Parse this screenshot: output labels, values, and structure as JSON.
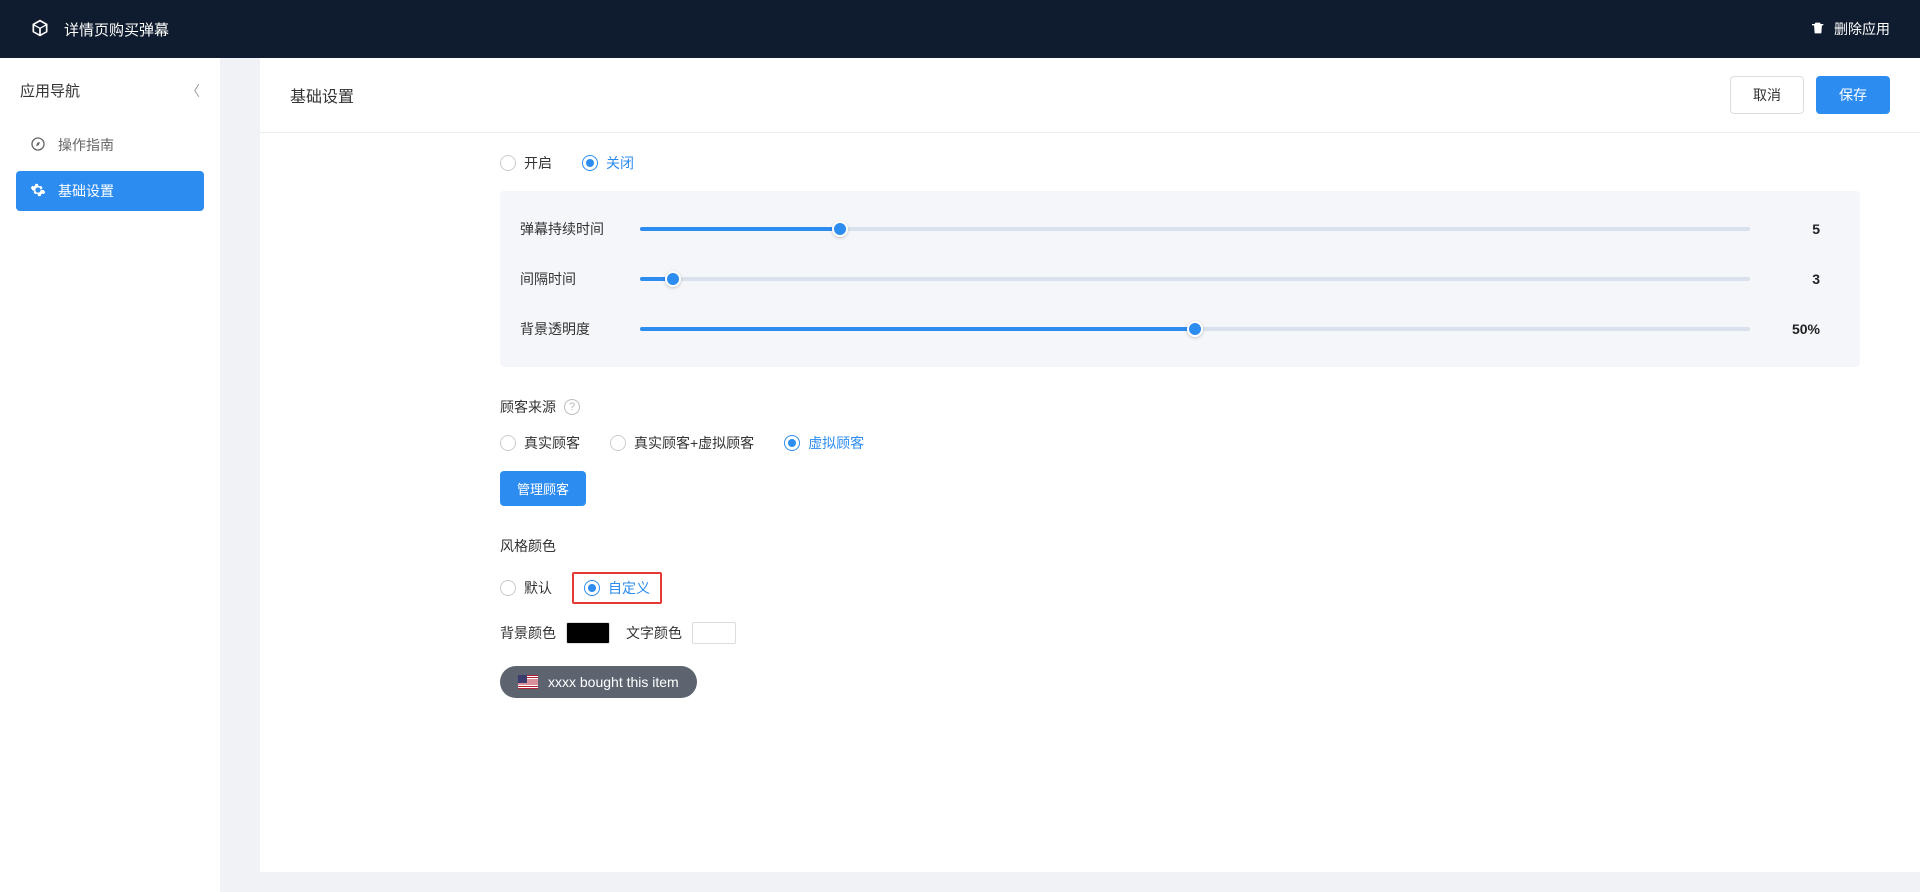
{
  "topbar": {
    "title": "详情页购买弹幕",
    "delete_label": "删除应用"
  },
  "sidebar": {
    "header": "应用导航",
    "items": [
      {
        "label": "操作指南"
      },
      {
        "label": "基础设置"
      }
    ]
  },
  "page": {
    "title": "基础设置",
    "cancel_label": "取消",
    "save_label": "保存"
  },
  "enable_section": {
    "options": {
      "on": "开启",
      "off": "关闭"
    },
    "selected": "off"
  },
  "sliders": {
    "duration": {
      "label": "弹幕持续时间",
      "value": "5",
      "percent": 18
    },
    "interval": {
      "label": "间隔时间",
      "value": "3",
      "percent": 3
    },
    "opacity": {
      "label": "背景透明度",
      "value": "50%",
      "percent": 50
    }
  },
  "customer_source": {
    "label": "顾客来源",
    "options": {
      "real": "真实顾客",
      "real_virtual": "真实顾客+虚拟顾客",
      "virtual": "虚拟顾客"
    },
    "selected": "virtual",
    "manage_label": "管理顾客"
  },
  "style": {
    "label": "风格颜色",
    "options": {
      "default": "默认",
      "custom": "自定义"
    },
    "selected": "custom",
    "bg_label": "背景颜色",
    "fg_label": "文字颜色",
    "bg_value": "#000000",
    "fg_value": "#ffffff",
    "preview_text": "xxxx bought this item"
  }
}
